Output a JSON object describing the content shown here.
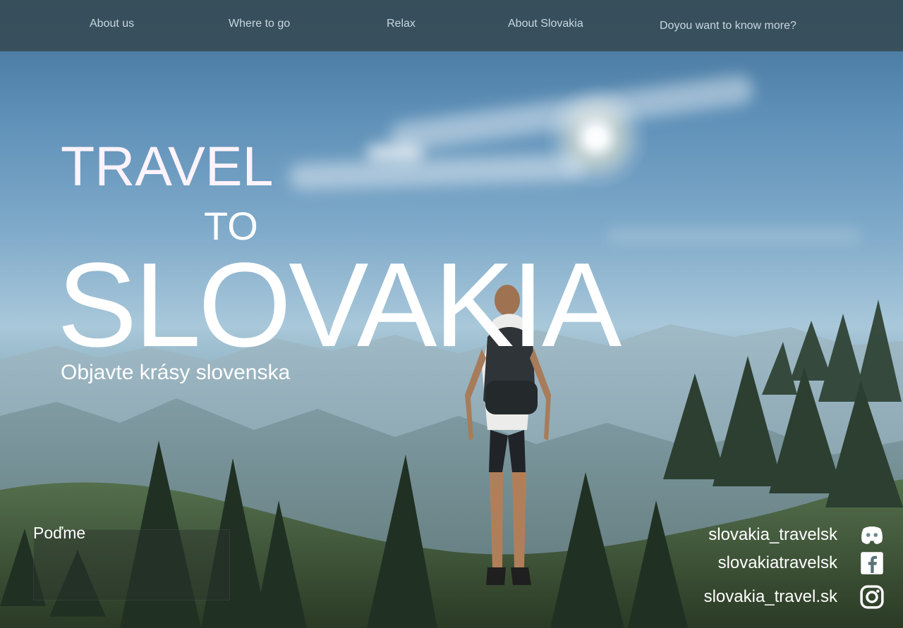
{
  "navigation": {
    "items": [
      {
        "label": "About us"
      },
      {
        "label": "Where to go"
      },
      {
        "label": "Relax"
      },
      {
        "label": "About Slovakia"
      },
      {
        "label": "Doyou want to know more?"
      }
    ]
  },
  "hero": {
    "title_line_1": "TRAVEL",
    "title_line_2": "TO",
    "title_line_3": "SLOVAKIA",
    "subtitle": "Objavte krásy slovenska"
  },
  "cta": {
    "label": "Poďme"
  },
  "social": [
    {
      "name": "discord-icon",
      "handle": "slovakia_travelsk"
    },
    {
      "name": "facebook-icon",
      "handle": "slovakiatravelsk"
    },
    {
      "name": "instagram-icon",
      "handle": "slovakia_travel.sk"
    }
  ],
  "colors": {
    "nav_bg": "#354952",
    "nav_text": "#c8d7e0",
    "hero_text": "#ffffff",
    "cta_bg": "#2a312c"
  }
}
